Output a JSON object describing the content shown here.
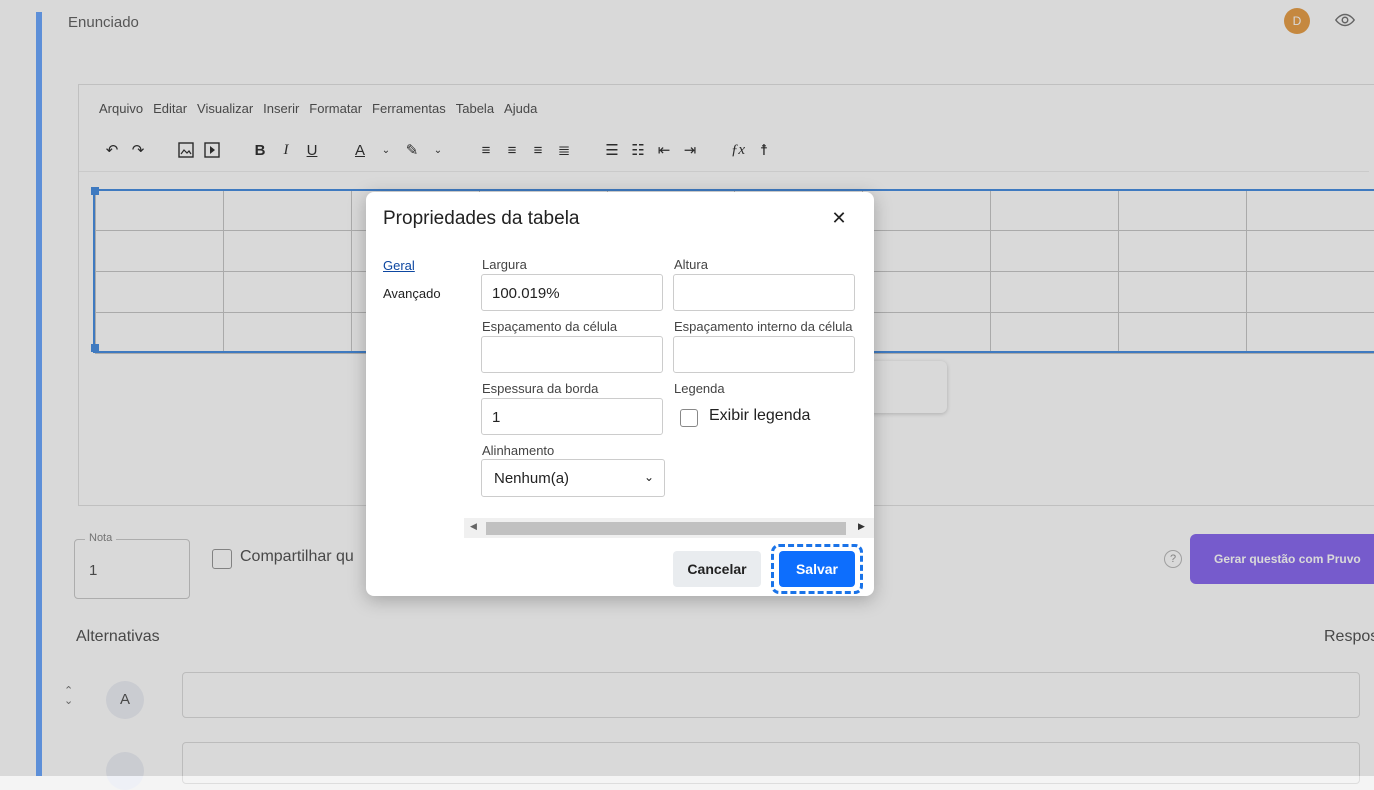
{
  "page": {
    "section_title": "Enunciado",
    "avatar_initial": "D",
    "menu": [
      "Arquivo",
      "Editar",
      "Visualizar",
      "Inserir",
      "Formatar",
      "Ferramentas",
      "Tabela",
      "Ajuda"
    ],
    "nota_label": "Nota",
    "nota_value": "1",
    "share_label": "Compartilhar qu",
    "help_symbol": "?",
    "generate_button": "Gerar questão com Pruvo",
    "alternatives_title": "Alternativas",
    "response_label": "Resposta",
    "alt_a": "A"
  },
  "dialog": {
    "title": "Propriedades da tabela",
    "tabs": [
      "Geral",
      "Avançado"
    ],
    "fields": {
      "largura_label": "Largura",
      "largura_value": "100.019%",
      "altura_label": "Altura",
      "altura_value": "",
      "espacamento_celula_label": "Espaçamento da célula",
      "espacamento_celula_value": "",
      "espacamento_interno_label": "Espaçamento interno da célula",
      "espacamento_interno_value": "",
      "espessura_borda_label": "Espessura da borda",
      "espessura_borda_value": "1",
      "legenda_label": "Legenda",
      "exibir_legenda_label": "Exibir legenda",
      "alinhamento_label": "Alinhamento",
      "alinhamento_value": "Nenhum(a)"
    },
    "cancel_label": "Cancelar",
    "save_label": "Salvar"
  },
  "colors": {
    "primary": "#0d6efd",
    "generate_button": "#8b6cf0",
    "avatar": "#e8a04a"
  }
}
